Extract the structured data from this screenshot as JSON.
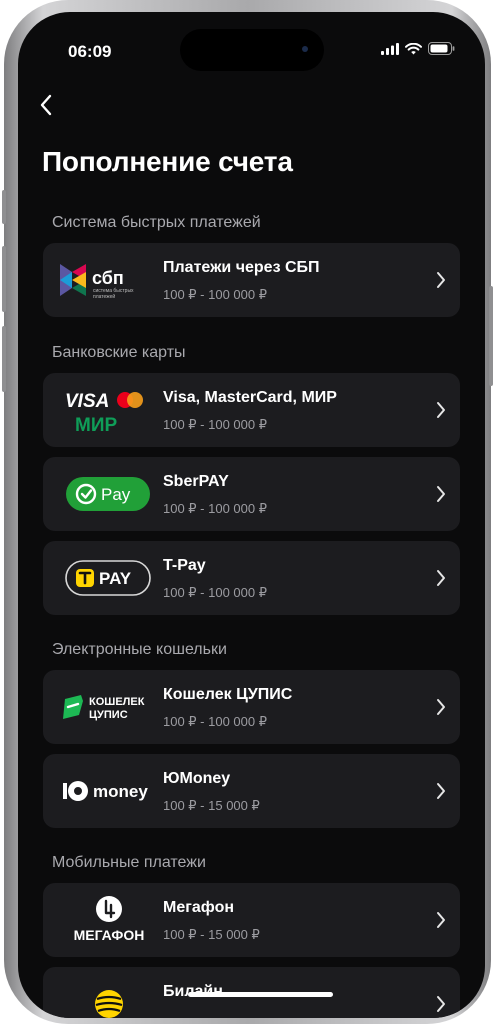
{
  "status": {
    "time": "06:09"
  },
  "header": {
    "title": "Пополнение счета"
  },
  "sections": [
    {
      "title": "Система быстрых платежей"
    },
    {
      "title": "Банковские карты"
    },
    {
      "title": "Электронные кошельки"
    },
    {
      "title": "Мобильные платежи"
    }
  ],
  "methods": [
    {
      "name": "Платежи через СБП",
      "range": "100 ₽ - 100 000 ₽",
      "logo_text": "сбп",
      "logo_sub1": "система быстрых",
      "logo_sub2": "платежей"
    },
    {
      "name": "Visa, MasterCard, МИР",
      "range": "100 ₽ - 100 000 ₽",
      "logo_text": "VISA",
      "logo_sub1": "МИР"
    },
    {
      "name": "SberPAY",
      "range": "100 ₽ - 100 000 ₽",
      "logo_text": "Pay"
    },
    {
      "name": "T-Pay",
      "range": "100 ₽ - 100 000 ₽",
      "logo_text": "PAY"
    },
    {
      "name": "Кошелек ЦУПИС",
      "range": "100 ₽ - 100 000 ₽",
      "logo_text": "КОШЕЛЕК",
      "logo_sub1": "ЦУПИС"
    },
    {
      "name": "ЮMoney",
      "range": "100 ₽ - 15 000 ₽",
      "logo_text": "money"
    },
    {
      "name": "Мегафон",
      "range": "100 ₽ - 15 000 ₽",
      "logo_text": "МЕГАФОН"
    },
    {
      "name": "Билайн"
    }
  ],
  "colors": {
    "background": "#0b0b0c",
    "card": "#1c1c1f",
    "sber_green": "#21a038",
    "mir_green": "#0f9d58",
    "yellow": "#ffd400"
  }
}
